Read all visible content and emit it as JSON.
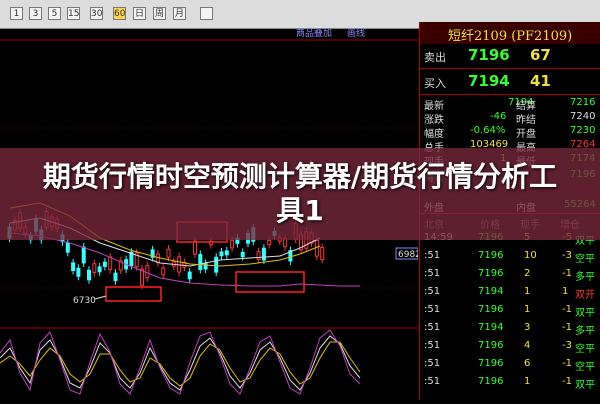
{
  "toolbar": {
    "buttons": [
      "1",
      "3",
      "5",
      "15",
      "30",
      "60",
      "日",
      "周",
      "月",
      "",
      ""
    ]
  },
  "chart": {
    "overlay_label": "商品叠加",
    "overlay_label2": "画线",
    "low_price_label": "6730",
    "right_price_label": "6982"
  },
  "panel": {
    "title": "短纤2109 (PF2109)",
    "sell": {
      "label": "卖出",
      "price": "7196",
      "volume": "67"
    },
    "buy": {
      "label": "买入",
      "price": "7194",
      "volume": "41"
    },
    "stats": [
      {
        "l1": "最新",
        "v1": "7194",
        "l2": "结算",
        "v2": "7216"
      },
      {
        "l1": "涨跌",
        "v1": "-46",
        "l2": "昨结",
        "v2": "7240"
      },
      {
        "l1": "幅度",
        "v1": "-0.64%",
        "l2": "开盘",
        "v2": "7230"
      },
      {
        "l1": "总手",
        "v1": "103469",
        "l2": "最高",
        "v2": "7264"
      },
      {
        "l1": "现手",
        "v1": "1",
        "l2": "最低",
        "v2": "7174"
      },
      {
        "l1": "持仓",
        "v1": "",
        "l2": "",
        "v2": "7196"
      },
      {
        "l1": "外盘",
        "v1": "",
        "l2": "内盘",
        "v2": "55264"
      }
    ],
    "trade_header": {
      "time": "北京",
      "price": "价格",
      "qty": "现手",
      "chg": "增仓"
    },
    "trades": [
      {
        "time": "14:59",
        "price": "7196",
        "qty": "5",
        "chg": "-5",
        "dir": "双平"
      },
      {
        "time": ":51",
        "price": "7196",
        "qty": "10",
        "chg": "-3",
        "dir": "空平"
      },
      {
        "time": ":51",
        "price": "7196",
        "qty": "2",
        "chg": "-1",
        "dir": "多平"
      },
      {
        "time": ":51",
        "price": "7194",
        "qty": "1",
        "chg": "1",
        "dir": "双开"
      },
      {
        "time": ":51",
        "price": "7196",
        "qty": "1",
        "chg": "-1",
        "dir": "双平"
      },
      {
        "time": ":51",
        "price": "7194",
        "qty": "3",
        "chg": "-1",
        "dir": "多平"
      },
      {
        "time": ":51",
        "price": "7196",
        "qty": "4",
        "chg": "-3",
        "dir": "空平"
      },
      {
        "time": ":51",
        "price": "7196",
        "qty": "6",
        "chg": "-1",
        "dir": "空平"
      },
      {
        "time": ":51",
        "price": "7196",
        "qty": "1",
        "chg": "-1",
        "dir": "双平"
      }
    ]
  },
  "banner": {
    "title": "期货行情时空预测计算器/期货行情分析工具1"
  },
  "colors": {
    "up": "#ff3333",
    "down": "#33ff33",
    "label": "#dddddd",
    "accent": "#f0e040"
  }
}
